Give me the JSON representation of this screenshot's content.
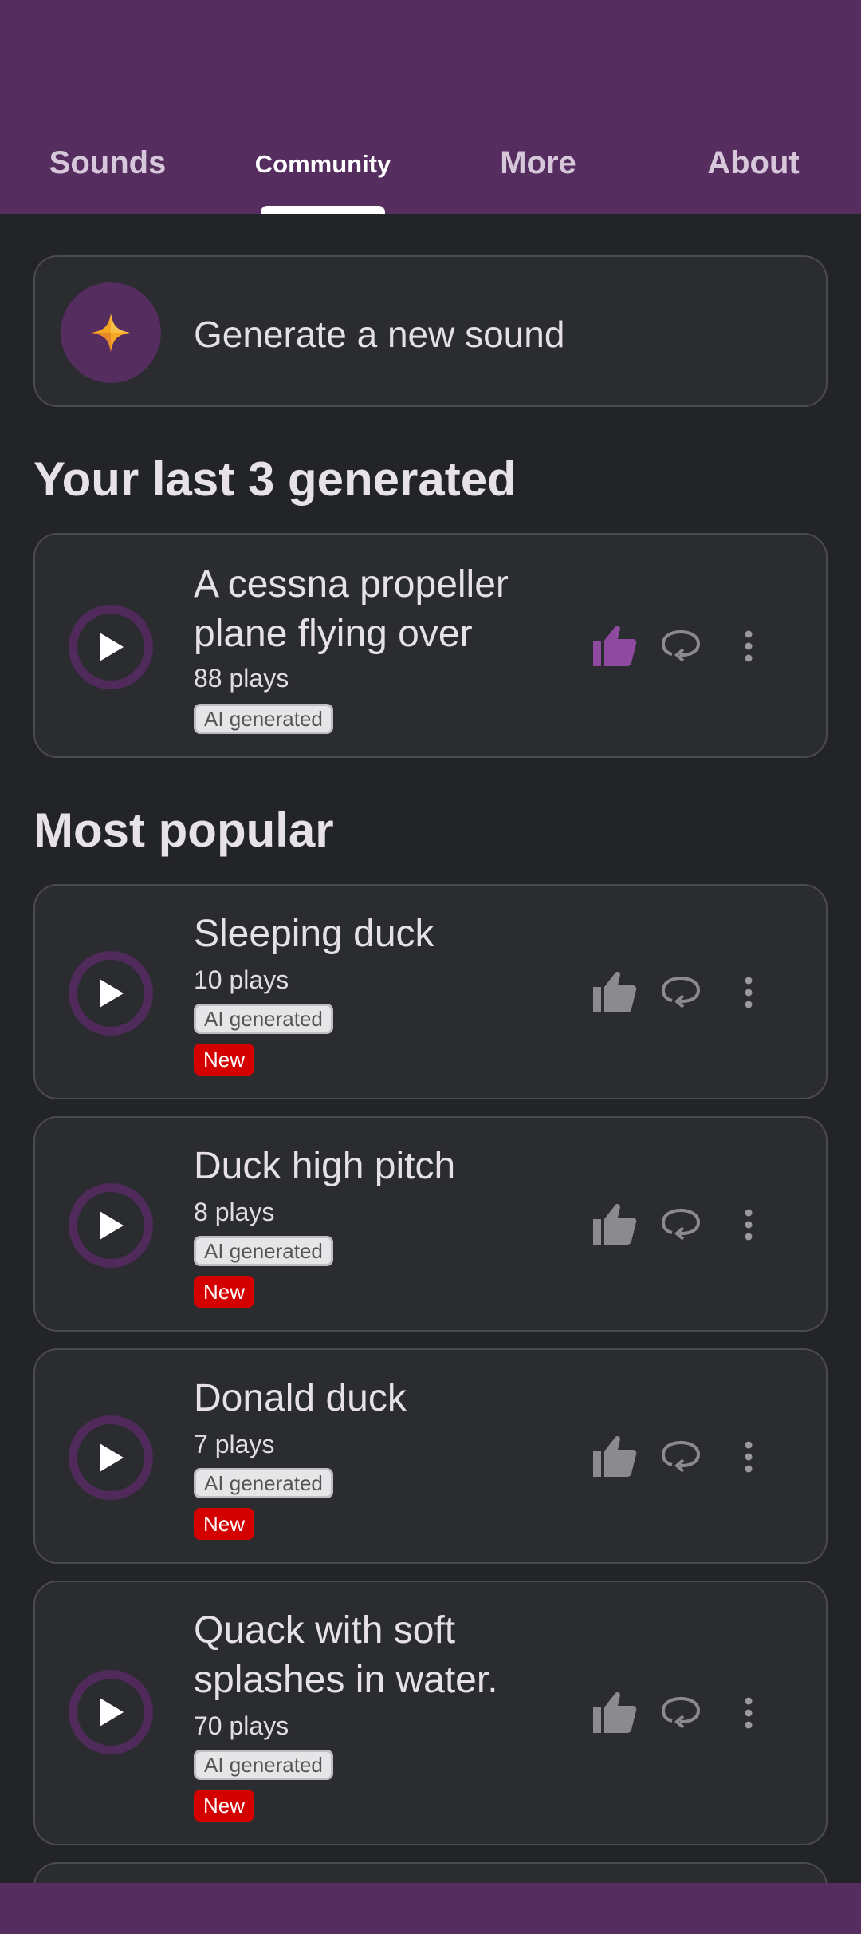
{
  "tabs": [
    {
      "label": "Sounds",
      "active": false
    },
    {
      "label": "Community",
      "active": true
    },
    {
      "label": "More",
      "active": false
    },
    {
      "label": "About",
      "active": false
    }
  ],
  "generate": {
    "label": "Generate a new sound",
    "icon": "sparkle-icon"
  },
  "last_generated": {
    "title": "Your last 3 generated",
    "items": [
      {
        "title_line1": "A cessna propeller",
        "title_line2": "plane flying over",
        "plays": "88 plays",
        "badge": "AI generated",
        "liked": true
      }
    ]
  },
  "popular": {
    "title": "Most popular",
    "items": [
      {
        "title_line1": "Sleeping duck",
        "title_line2": "",
        "plays": "10 plays",
        "badge": "AI generated",
        "new_label": "New",
        "liked": false
      },
      {
        "title_line1": "Duck high pitch",
        "title_line2": "",
        "plays": "8 plays",
        "badge": "AI generated",
        "new_label": "New",
        "liked": false
      },
      {
        "title_line1": "Donald duck",
        "title_line2": "",
        "plays": "7 plays",
        "badge": "AI generated",
        "new_label": "New",
        "liked": false
      },
      {
        "title_line1": "Quack with soft",
        "title_line2": "splashes in water.",
        "plays": "70 plays",
        "badge": "AI generated",
        "new_label": "New",
        "liked": false
      }
    ]
  },
  "colors": {
    "header": "#552d5f",
    "background": "#232427",
    "card": "#2b2c30",
    "liked": "#8e4a9e",
    "icon_gray": "#8b8b8f",
    "new_badge": "#d40000",
    "sparkle": "#f5a623"
  }
}
